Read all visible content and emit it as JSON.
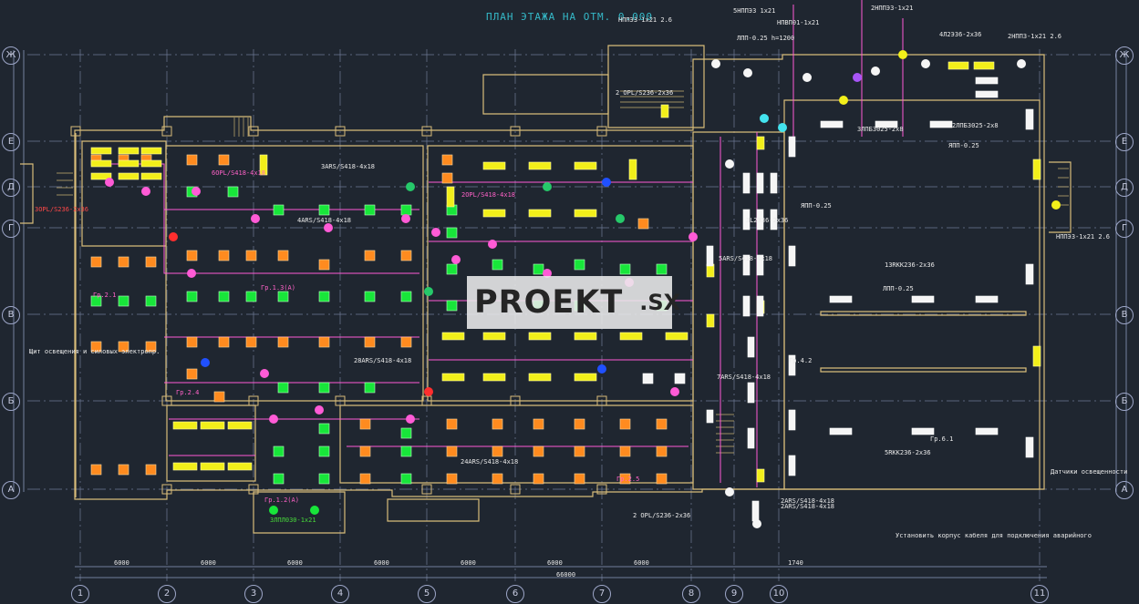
{
  "title": "ПЛАН ЭТАЖА НА ОТМ. 0.000",
  "watermark": {
    "main": "PROEKT",
    "suffix": ".SX"
  },
  "colors": {
    "background": "#1f2630",
    "wall": "#d8bc7a",
    "grid": "#7f8aa8",
    "cable": "#ff5bd6",
    "fixture_orange": "#ff8b1f",
    "fixture_green": "#18e63a",
    "fixture_yellow": "#f2ef1a",
    "fixture_white": "#f5f5f5"
  },
  "axes": {
    "columns": [
      "1",
      "2",
      "3",
      "4",
      "5",
      "6",
      "7",
      "8",
      "9",
      "10",
      "11"
    ],
    "rows": [
      "Ж",
      "Е",
      "Д",
      "Г",
      "В",
      "Б",
      "А"
    ]
  },
  "dimensions": [
    "6000",
    "6000",
    "6000",
    "6000",
    "6000",
    "6000",
    "6000",
    "1740",
    "66000"
  ],
  "annotations": [
    {
      "text": "НППЭ3-1x21 2.6",
      "color": "white"
    },
    {
      "text": "5НППЭ3 1x21",
      "color": "white"
    },
    {
      "text": "НПВП01-1x21",
      "color": "white"
    },
    {
      "text": "2НППЭ3-1x21",
      "color": "white"
    },
    {
      "text": "2НПП3-1x21 2.6",
      "color": "white"
    },
    {
      "text": "4Л2Э36-2x36",
      "color": "white"
    },
    {
      "text": "ЛПП-0.25 h=1200",
      "color": "white"
    },
    {
      "text": "2 ОРL/S236-2x36",
      "color": "white"
    },
    {
      "text": "3ЛПБ3025-2x8",
      "color": "white"
    },
    {
      "text": "2ЛПБ3025-2x8",
      "color": "white"
    },
    {
      "text": "ЯПП-0.25",
      "color": "white"
    },
    {
      "text": "6ОРL/S418-4x18",
      "color": "pink"
    },
    {
      "text": "3ОРL/S236-2x36",
      "color": "red"
    },
    {
      "text": "3ARS/S418-4x18",
      "color": "white"
    },
    {
      "text": "4ARS/S418-4x18",
      "color": "white"
    },
    {
      "text": "2ОРL/S418-4x18",
      "color": "pink"
    },
    {
      "text": "5ARS/S418-4x18",
      "color": "white"
    },
    {
      "text": "3L2336-2x36",
      "color": "white"
    },
    {
      "text": "13RКК236-2x36",
      "color": "white"
    },
    {
      "text": "5RКК236-2x36",
      "color": "white"
    },
    {
      "text": "7ARS/S418-4x18",
      "color": "white"
    },
    {
      "text": "2ARS/S418-4x18",
      "color": "white"
    },
    {
      "text": "24ARS/S418-4x18",
      "color": "white"
    },
    {
      "text": "28ARS/S418-4x18",
      "color": "white"
    },
    {
      "text": "ЯПП-0.25",
      "color": "white"
    },
    {
      "text": "НППЭ3-1x21 2.6",
      "color": "white"
    },
    {
      "text": "Щит освещения и силовых электропр.",
      "color": "white"
    },
    {
      "text": "Датчики освещенности",
      "color": "white"
    },
    {
      "text": "Установить корпус кабеля для подключения аварийного",
      "color": "white"
    },
    {
      "text": "2 ОРL/S236-2x36",
      "color": "white"
    },
    {
      "text": "2ARS/S418-4x18",
      "color": "white"
    },
    {
      "text": "ЛПП-0.25",
      "color": "white"
    },
    {
      "text": "3ЛПЛ030-1x21",
      "color": "green"
    },
    {
      "text": "Гр.6.1",
      "color": "white"
    },
    {
      "text": "Гр.4.2",
      "color": "white"
    },
    {
      "text": "Гр.2.1",
      "color": "pink"
    },
    {
      "text": "Гр.2.4",
      "color": "pink"
    },
    {
      "text": "Гр.1.3(А)",
      "color": "pink"
    },
    {
      "text": "Гр.1.2(А)",
      "color": "pink"
    },
    {
      "text": "Гр.2.5",
      "color": "pink"
    }
  ]
}
